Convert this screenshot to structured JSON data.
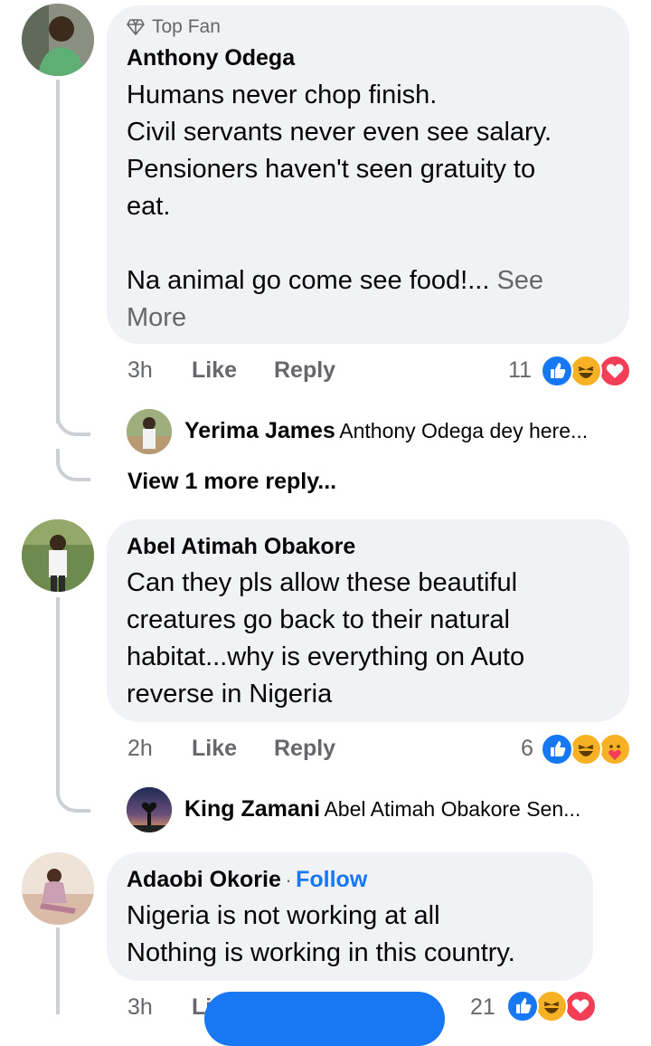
{
  "comments": [
    {
      "badge": "Top Fan",
      "author": "Anthony Odega",
      "lines": [
        "Humans never chop finish.",
        "Civil servants never even see salary.",
        "Pensioners haven't seen gratuity to",
        "eat."
      ],
      "line_after_gap": "Na animal go come see food!...",
      "see_more_1": "See",
      "see_more_2": "More",
      "time": "3h",
      "like": "Like",
      "reply": "Reply",
      "reaction_count": "11"
    },
    {
      "author": "Abel Atimah Obakore",
      "lines": [
        "Can they pls allow these beautiful",
        "creatures go back to their natural",
        "habitat...why is everything on Auto",
        "reverse in Nigeria"
      ],
      "time": "2h",
      "like": "Like",
      "reply": "Reply",
      "reaction_count": "6"
    },
    {
      "author": "Adaobi Okorie",
      "follow_sep": "·",
      "follow": "Follow",
      "lines": [
        "Nigeria is not working at all",
        "Nothing is working in this country."
      ],
      "time": "3h",
      "like": "Li",
      "reaction_count": "21"
    }
  ],
  "replies": [
    {
      "name": "Yerima James",
      "text": "Anthony Odega dey here..."
    },
    {
      "name": "King  Zamani",
      "text": "Abel Atimah Obakore Sen..."
    }
  ],
  "view_more_replies": "View 1 more reply...",
  "colors": {
    "like_blue": "#1877f2",
    "love_red": "#f33e58",
    "haha_yellow": "#f7b125",
    "bubble": "#f0f2f5",
    "meta_gray": "#65676b"
  }
}
